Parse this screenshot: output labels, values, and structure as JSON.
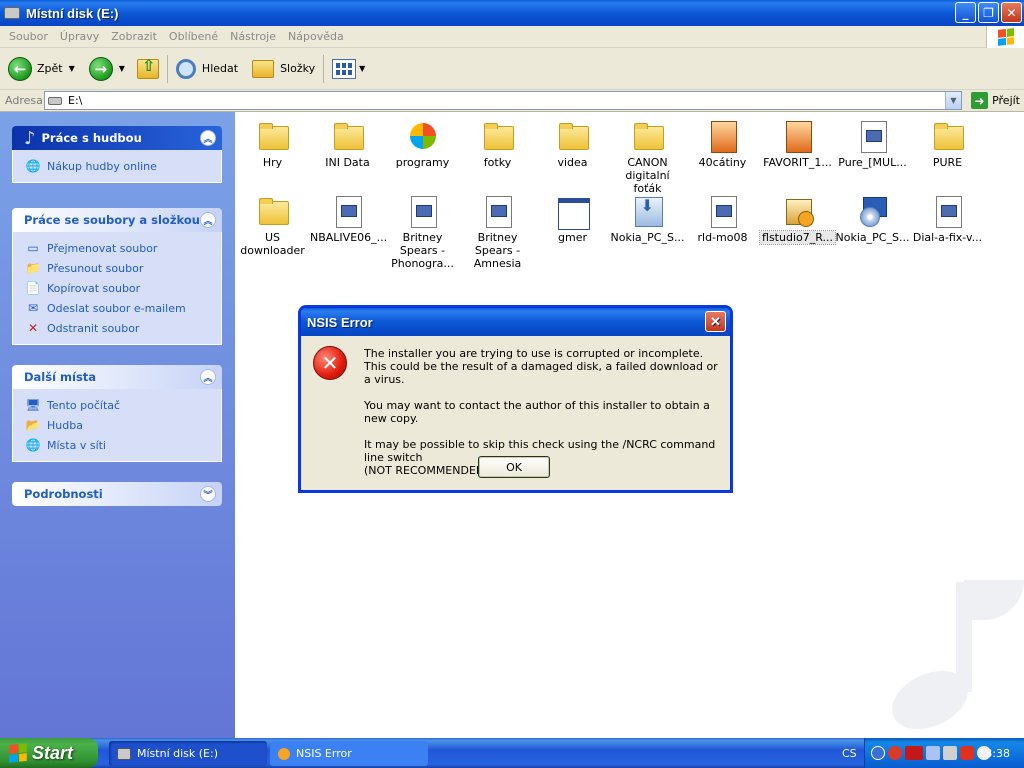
{
  "window": {
    "title": "Místní disk (E:)"
  },
  "menu": [
    "Soubor",
    "Úpravy",
    "Zobrazit",
    "Oblíbené",
    "Nástroje",
    "Nápověda"
  ],
  "toolbar": {
    "back_label": "Zpět",
    "search_label": "Hledat",
    "folders_label": "Složky"
  },
  "address": {
    "label": "Adresa",
    "value": "E:\\",
    "go_label": "Přejít"
  },
  "sidebar": {
    "music_panel": {
      "title": "Práce s hudbou",
      "items": [
        "Nákup hudby online"
      ]
    },
    "files_panel": {
      "title": "Práce se soubory a složkou",
      "items": [
        "Přejmenovat soubor",
        "Přesunout soubor",
        "Kopírovat soubor",
        "Odeslat soubor e-mailem",
        "Odstranit soubor"
      ]
    },
    "places_panel": {
      "title": "Další místa",
      "items": [
        "Tento počítač",
        "Hudba",
        "Místa v síti"
      ]
    },
    "details_panel": {
      "title": "Podrobnosti"
    }
  },
  "files": [
    {
      "name": "Hry",
      "icon": "folder"
    },
    {
      "name": "INI Data",
      "icon": "folder"
    },
    {
      "name": "programy",
      "icon": "xp"
    },
    {
      "name": "fotky",
      "icon": "folder"
    },
    {
      "name": "videa",
      "icon": "folder"
    },
    {
      "name": "CANON digitalní foťák",
      "icon": "folder"
    },
    {
      "name": "40cátiny",
      "icon": "media"
    },
    {
      "name": "FAVORIT_1...",
      "icon": "media"
    },
    {
      "name": "Pure_[MUL...",
      "icon": "doc"
    },
    {
      "name": "PURE",
      "icon": "folder"
    },
    {
      "name": "US downloader",
      "icon": "folder"
    },
    {
      "name": "NBALIVE06_...",
      "icon": "doc"
    },
    {
      "name": "Britney Spears - Phonogra...",
      "icon": "doc"
    },
    {
      "name": "Britney Spears - Amnesia",
      "icon": "doc"
    },
    {
      "name": "gmer",
      "icon": "win"
    },
    {
      "name": "Nokia_PC_S...",
      "icon": "dl"
    },
    {
      "name": "rld-mo08",
      "icon": "doc"
    },
    {
      "name": "flstudio7_R...",
      "icon": "setup"
    },
    {
      "name": "Nokia_PC_S...",
      "icon": "cd"
    },
    {
      "name": "Dial-a-fix-v...",
      "icon": "doc"
    }
  ],
  "dialog": {
    "title": "NSIS Error",
    "line1": "The installer you are trying to use is corrupted or incomplete.\nThis could be the result of a damaged disk, a failed download or a virus.",
    "line2": "You may want to contact the author of this installer to obtain a new copy.",
    "line3": "It may be possible to skip this check using the /NCRC command line switch\n(NOT RECOMMENDED).",
    "ok_label": "OK"
  },
  "taskbar": {
    "start_label": "Start",
    "tasks": [
      "Místní disk (E:)",
      "NSIS Error"
    ],
    "language": "CS",
    "clock": "18:38"
  }
}
